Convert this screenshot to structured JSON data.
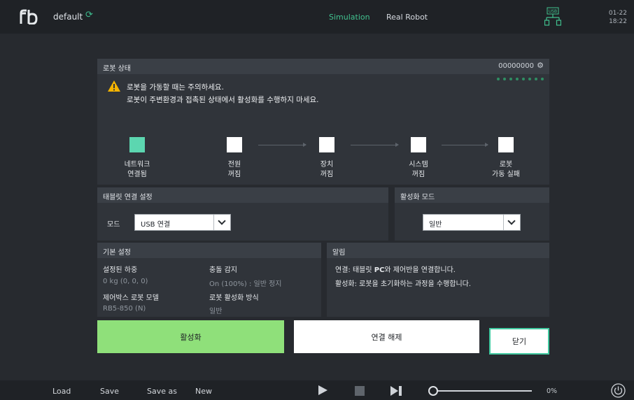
{
  "topbar": {
    "program_name": "default",
    "mode_simulation": "Simulation",
    "mode_real": "Real Robot",
    "usb_label": "USB",
    "date": "01-22",
    "time": "18:22"
  },
  "status": {
    "title": "로봇 상태",
    "serial": "00000000",
    "warning_line1": "로봇을 가동할 때는 주의하세요.",
    "warning_line2": "로봇이 주변환경과 접촉된 상태에서 활성화를 수행하지 마세요.",
    "steps": [
      {
        "line1": "네트워크",
        "line2": "연결됨",
        "done": true
      },
      {
        "line1": "전원",
        "line2": "꺼짐",
        "done": false
      },
      {
        "line1": "장치",
        "line2": "꺼짐",
        "done": false
      },
      {
        "line1": "시스템",
        "line2": "꺼짐",
        "done": false
      },
      {
        "line1": "로봇",
        "line2": "가동 실패",
        "done": false
      }
    ]
  },
  "tablet": {
    "title": "태블릿 연결 설정",
    "mode_label": "모드",
    "mode_value": "USB 연결"
  },
  "activation": {
    "title": "활성화 모드",
    "mode_value": "일반"
  },
  "basic": {
    "title": "기본 설정",
    "payload_label": "설정된 하중",
    "payload_value": "0 kg (0, 0, 0)",
    "collision_label": "충돌 감지",
    "collision_value": "On (100%) : 일반 정지",
    "model_label": "제어박스 로봇 모델",
    "model_value": "RB5-850 (N)",
    "activation_method_label": "로봇 활성화 방식",
    "activation_method_value": "일반"
  },
  "notice": {
    "title": "알림",
    "line1_prefix": "연결: 태블릿 ",
    "line1_bold": "PC",
    "line1_suffix": "와 제어반을 연결합니다.",
    "line2": "활성화: 로봇을 초기화하는 과정을 수행합니다."
  },
  "buttons": {
    "activate": "활성화",
    "disconnect": "연결 해제",
    "close": "닫기"
  },
  "bottombar": {
    "load": "Load",
    "save": "Save",
    "save_as": "Save as",
    "new": "New",
    "speed_percent": "0%",
    "speed_value": 0
  },
  "colors": {
    "accent": "#41c28f",
    "activate_button": "#8fe07a",
    "step_done": "#5cd6b0"
  }
}
